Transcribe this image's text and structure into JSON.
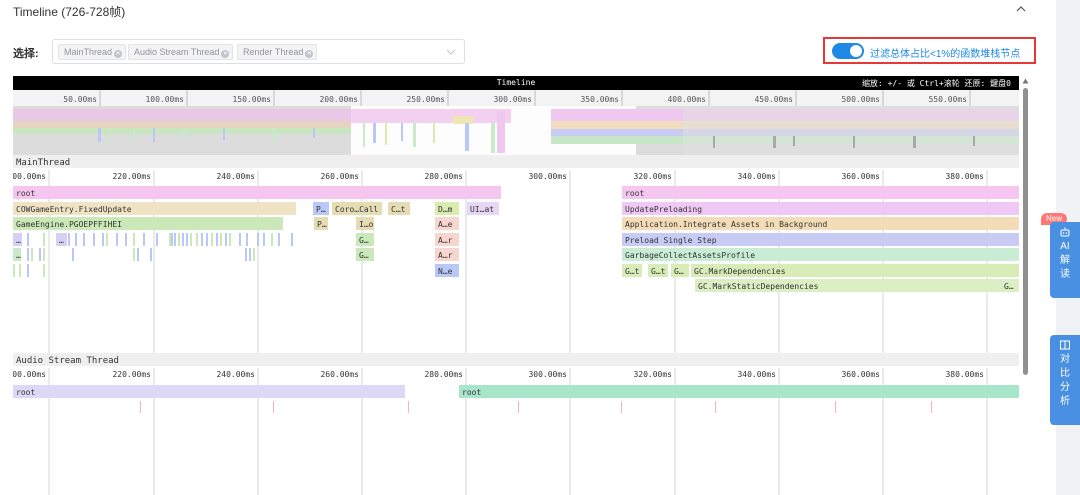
{
  "header": {
    "title": "Timeline (726-728帧)"
  },
  "filter": {
    "label": "选择:",
    "tags": [
      "MainThread",
      "Audio Stream Thread",
      "Render Thread"
    ],
    "toggle_label": "过滤总体占比<1%的函数堆栈节点",
    "toggle_on": true
  },
  "timeline": {
    "title": "Timeline",
    "hint": "缩放: +/- 或 Ctrl+滚轮  还原: 鍵盘0",
    "overview_ticks": [
      "50.00ms",
      "100.00ms",
      "150.00ms",
      "200.00ms",
      "250.00ms",
      "300.00ms",
      "350.00ms",
      "400.00ms",
      "450.00ms",
      "500.00ms",
      "550.00ms"
    ],
    "detail_ticks": [
      "00.00ms",
      "220.00ms",
      "240.00ms",
      "260.00ms",
      "280.00ms",
      "300.00ms",
      "320.00ms",
      "340.00ms",
      "360.00ms",
      "380.00ms"
    ],
    "threads": [
      {
        "name": "MainThread",
        "blocks": [
          {
            "label": "root",
            "color": "#f5c6ef"
          },
          {
            "label": "COWGameEntry.FixedUpdate",
            "color": "#f0e3c4"
          },
          {
            "label": "GameEngine.PGOEPFFIHEI",
            "color": "#cbe8b8"
          },
          {
            "label": "…",
            "color": "#d6d0f5"
          },
          {
            "label": "…",
            "color": "#d6d0f5"
          },
          {
            "label": "…",
            "color": "#c8eac8"
          },
          {
            "label": "P…",
            "color": "#b9c8f7"
          },
          {
            "label": "Coro…Call",
            "color": "#e6dcb4"
          },
          {
            "label": "C…t",
            "color": "#e6dcb4"
          },
          {
            "label": "P…",
            "color": "#e6dcb4"
          },
          {
            "label": "I…o",
            "color": "#e6dcb4"
          },
          {
            "label": "G…",
            "color": "#cbe8b8"
          },
          {
            "label": "G…",
            "color": "#cbe8b8"
          },
          {
            "label": "D…m",
            "color": "#d8ecb0"
          },
          {
            "label": "UI…at",
            "color": "#e8d6f5"
          },
          {
            "label": "A…e",
            "color": "#f7d6cf"
          },
          {
            "label": "A…r",
            "color": "#f7d6cf"
          },
          {
            "label": "A…r",
            "color": "#f7d6cf"
          },
          {
            "label": "N…e",
            "color": "#b9c8f7"
          },
          {
            "label": "root",
            "color": "#f5c6ef"
          },
          {
            "label": "UpdatePreloading",
            "color": "#f0c8f5"
          },
          {
            "label": "Application.Integrate Assets in Background",
            "color": "#f5dcb8"
          },
          {
            "label": "Preload Single Step",
            "color": "#c8ccf5"
          },
          {
            "label": "GarbageCollectAssetsProfile",
            "color": "#c8ecd4"
          },
          {
            "label": "G…t",
            "color": "#d8ecb8"
          },
          {
            "label": "G…t",
            "color": "#d8ecb8"
          },
          {
            "label": "G…",
            "color": "#d8ecb8"
          },
          {
            "label": "GC.MarkDependencies",
            "color": "#d8ecb8"
          },
          {
            "label": "GC.MarkStaticDependencies",
            "color": "#dcefc4"
          },
          {
            "label": "G…",
            "color": "#dcefc4"
          }
        ]
      },
      {
        "name": "Audio Stream Thread",
        "blocks": [
          {
            "label": "root",
            "color": "#ddd8f5"
          },
          {
            "label": "root",
            "color": "#a8e6cc"
          }
        ]
      }
    ]
  },
  "side_buttons": {
    "badge": "New",
    "ai": {
      "icon": "robot-icon",
      "line1": "AI",
      "line2": "解",
      "line3": "读"
    },
    "compare": {
      "icon": "compare-icon",
      "line1": "对",
      "line2": "比",
      "line3": "分",
      "line4": "析"
    }
  },
  "colors": {
    "accent": "#1e88e5",
    "highlight_border": "#e53935",
    "side_button": "#4a90e2"
  }
}
